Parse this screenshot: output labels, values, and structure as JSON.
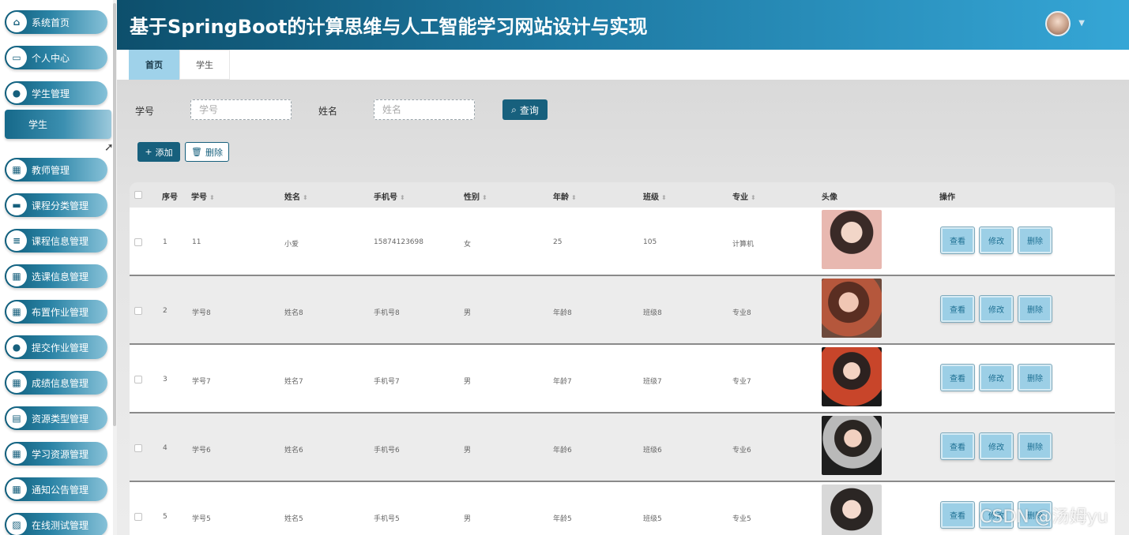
{
  "header": {
    "title": "基于SpringBoot的计算思维与人工智能学习网站设计与实现"
  },
  "sidebar": {
    "items": [
      {
        "label": "系统首页",
        "icon": "home-icon",
        "glyph": "⌂"
      },
      {
        "label": "个人中心",
        "icon": "window-icon",
        "glyph": "▭"
      },
      {
        "label": "学生管理",
        "icon": "user-icon",
        "glyph": "●"
      },
      {
        "label": "教师管理",
        "icon": "grid-icon",
        "glyph": "▦"
      },
      {
        "label": "课程分类管理",
        "icon": "ticket-icon",
        "glyph": "▬"
      },
      {
        "label": "课程信息管理",
        "icon": "list-icon",
        "glyph": "≡"
      },
      {
        "label": "选课信息管理",
        "icon": "grid-icon",
        "glyph": "▦"
      },
      {
        "label": "布置作业管理",
        "icon": "grid-icon",
        "glyph": "▦"
      },
      {
        "label": "提交作业管理",
        "icon": "user-icon",
        "glyph": "●"
      },
      {
        "label": "成绩信息管理",
        "icon": "grid-icon",
        "glyph": "▦"
      },
      {
        "label": "资源类型管理",
        "icon": "briefcase-icon",
        "glyph": "▤"
      },
      {
        "label": "学习资源管理",
        "icon": "grid-icon",
        "glyph": "▦"
      },
      {
        "label": "通知公告管理",
        "icon": "table-icon",
        "glyph": "▦"
      },
      {
        "label": "在线测试管理",
        "icon": "chart-icon",
        "glyph": "▨"
      }
    ],
    "submenu": {
      "label": "学生"
    }
  },
  "tabs": [
    {
      "label": "首页",
      "active": true
    },
    {
      "label": "学生",
      "active": false
    }
  ],
  "search": {
    "student_no_label": "学号",
    "student_no_placeholder": "学号",
    "name_label": "姓名",
    "name_placeholder": "姓名",
    "search_button": "查询"
  },
  "toolbar": {
    "add_label": "添加",
    "delete_label": "删除"
  },
  "table": {
    "columns": [
      "序号",
      "学号",
      "姓名",
      "手机号",
      "性别",
      "年龄",
      "班级",
      "专业",
      "头像",
      "操作"
    ],
    "actions": {
      "view": "查看",
      "edit": "修改",
      "delete": "删除"
    },
    "rows": [
      {
        "index": "1",
        "student_no": "11",
        "name": "小爱",
        "phone": "15874123698",
        "gender": "女",
        "age": "25",
        "class": "105",
        "major": "计算机"
      },
      {
        "index": "2",
        "student_no": "学号8",
        "name": "姓名8",
        "phone": "手机号8",
        "gender": "男",
        "age": "年龄8",
        "class": "班级8",
        "major": "专业8"
      },
      {
        "index": "3",
        "student_no": "学号7",
        "name": "姓名7",
        "phone": "手机号7",
        "gender": "男",
        "age": "年龄7",
        "class": "班级7",
        "major": "专业7"
      },
      {
        "index": "4",
        "student_no": "学号6",
        "name": "姓名6",
        "phone": "手机号6",
        "gender": "男",
        "age": "年龄6",
        "class": "班级6",
        "major": "专业6"
      },
      {
        "index": "5",
        "student_no": "学号5",
        "name": "姓名5",
        "phone": "手机号5",
        "gender": "男",
        "age": "年龄5",
        "class": "班级5",
        "major": "专业5"
      }
    ]
  },
  "watermark": "CSDN @汤姆yu",
  "colors": {
    "primary": "#17607d",
    "header_start": "#0d4f6c",
    "header_end": "#35a6d6",
    "action_button": "#9ccfe6"
  }
}
